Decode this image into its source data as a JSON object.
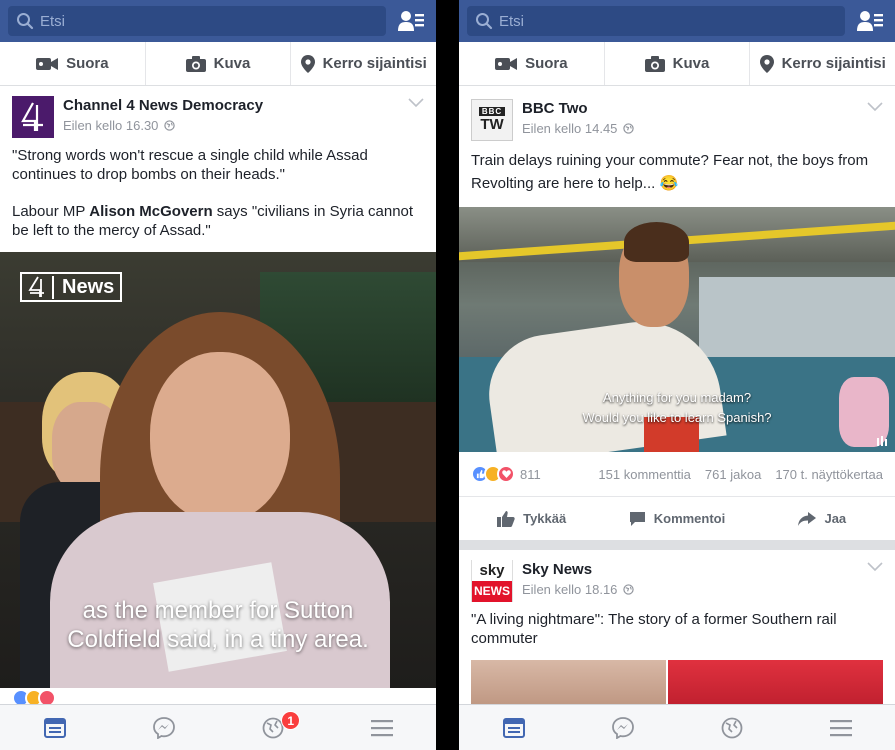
{
  "left": {
    "search_placeholder": "Etsi",
    "composer": {
      "live": "Suora",
      "photo": "Kuva",
      "checkin": "Kerro sijaintisi"
    },
    "post": {
      "page_name": "Channel 4 News Democracy",
      "time": "Eilen kello 16.30",
      "quote": "\"Strong words won't rescue a single child while Assad continues to drop bombs on their heads.\"",
      "line2_pre": "Labour MP ",
      "line2_bold": "Alison McGovern",
      "line2_post": " says \"civilians in Syria cannot be left to the mercy of Assad.\"",
      "video_logo": "News",
      "caption": "as the member for Sutton Coldfield said, in a tiny area."
    },
    "notification_badge": "1"
  },
  "right": {
    "search_placeholder": "Etsi",
    "composer": {
      "live": "Suora",
      "photo": "Kuva",
      "checkin": "Kerro sijaintisi"
    },
    "post": {
      "page_name": "BBC Two",
      "avatar_text_top": "BBC",
      "avatar_text_bottom": "TW",
      "time": "Eilen kello 14.45",
      "text": "Train delays ruining your commute? Fear not, the boys from Revolting are here to help... 😂",
      "subtitle_line1": "Anything for you madam?",
      "subtitle_line2": "Would you like to learn Spanish?",
      "reaction_count": "811",
      "comments": "151 kommenttia",
      "shares": "761 jakoa",
      "views": "170 t. näyttökertaa",
      "like_label": "Tykkää",
      "comment_label": "Kommentoi",
      "share_label": "Jaa"
    },
    "post2": {
      "page_name": "Sky News",
      "avatar_text_top": "sky",
      "avatar_text_bottom": "NEWS",
      "time": "Eilen kello 18.16",
      "text": "\"A living nightmare\": The story of a former Southern rail commuter"
    }
  },
  "colors": {
    "facebook_blue": "#3b5998",
    "c4_purple": "#4b1a6b",
    "sky_red": "#e2132b",
    "badge_red": "#fa3e3e"
  }
}
